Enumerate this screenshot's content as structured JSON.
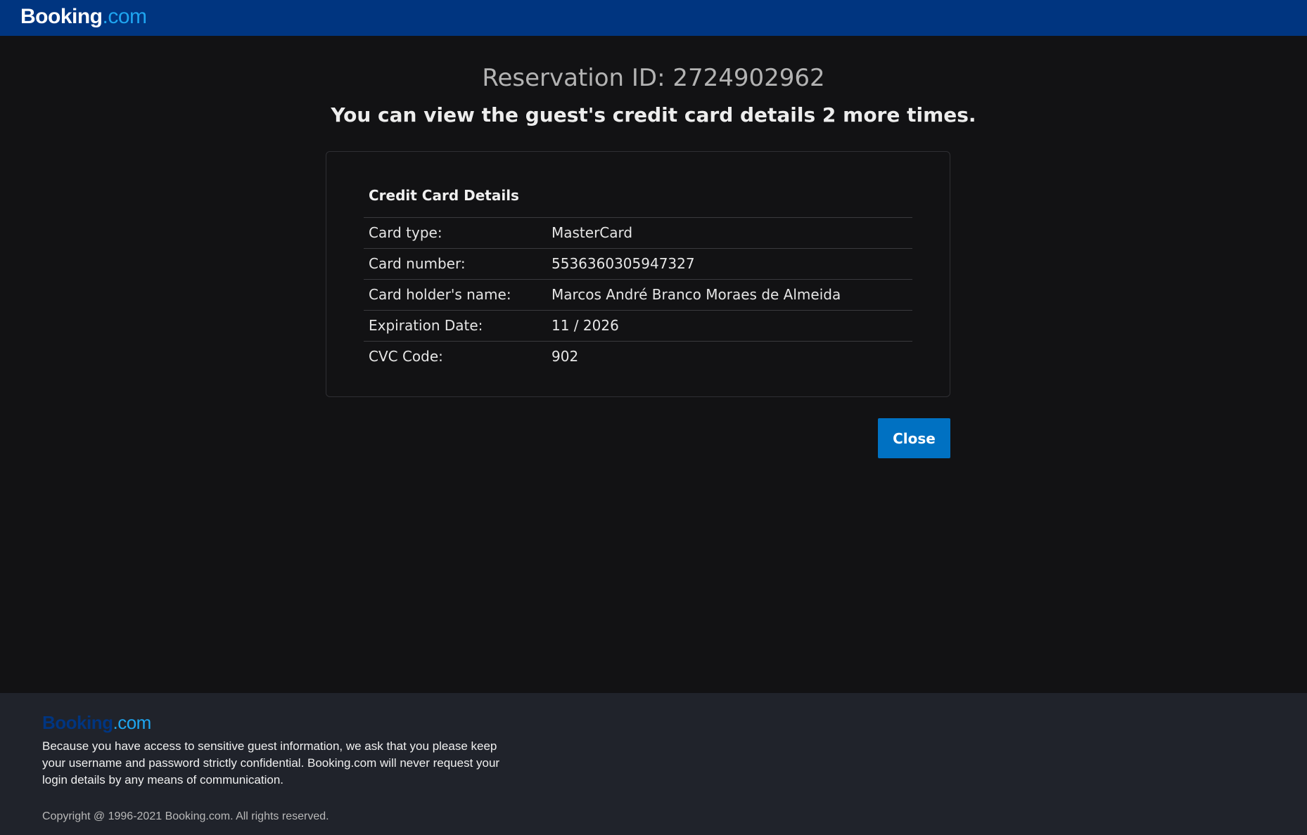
{
  "header": {
    "logo_main": "Booking",
    "logo_suffix": ".com"
  },
  "page": {
    "reservation_id": "Reservation ID: 2724902962",
    "view_note": "You can view the guest's credit card details 2 more times."
  },
  "card": {
    "title": "Credit Card Details",
    "rows": [
      {
        "label": "Card type:",
        "value": "MasterCard"
      },
      {
        "label": "Card number:",
        "value": "5536360305947327"
      },
      {
        "label": "Card holder's name:",
        "value": "Marcos André Branco Moraes de Almeida"
      },
      {
        "label": "Expiration Date:",
        "value": "11 / 2026"
      },
      {
        "label": "CVC Code:",
        "value": "902"
      }
    ]
  },
  "actions": {
    "close_label": "Close"
  },
  "footer": {
    "logo_main": "Booking",
    "logo_suffix": ".com",
    "notice": "Because you have access to sensitive guest information, we ask that you please keep your username and password strictly confidential. Booking.com will never request your login details by any means of communication.",
    "copyright": "Copyright @ 1996-2021 Booking.com. All rights reserved."
  },
  "colors": {
    "header_bg": "#003580",
    "page_bg": "#121214",
    "footer_bg": "#20232b",
    "button_bg": "#0071c2",
    "logo_accent": "#1ea5f0"
  }
}
